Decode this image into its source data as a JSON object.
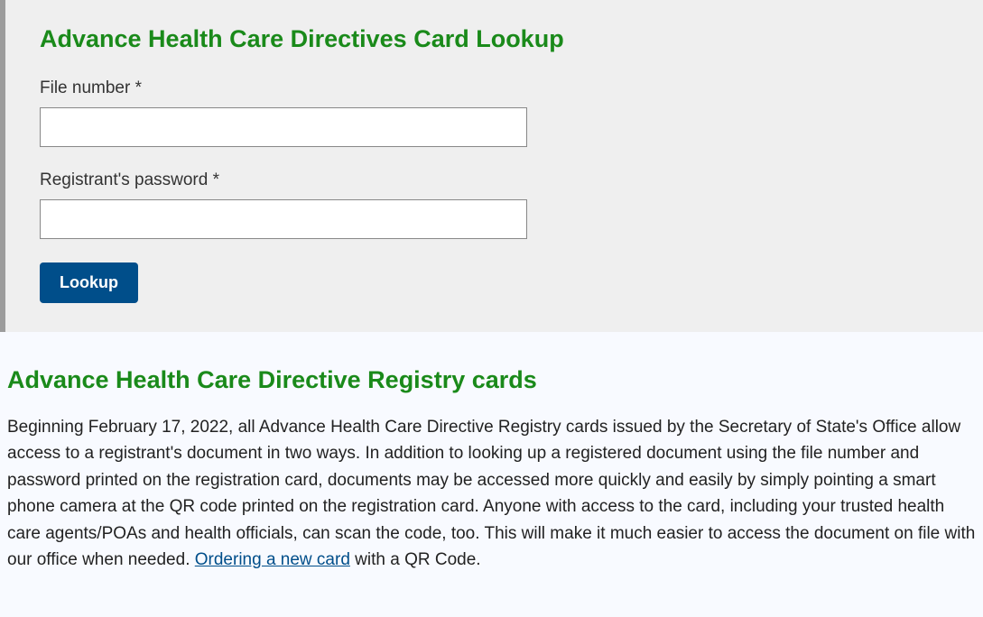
{
  "lookup": {
    "title": "Advance Health Care Directives Card Lookup",
    "file_number_label": "File number *",
    "password_label": "Registrant's password *",
    "button_label": "Lookup"
  },
  "content": {
    "title": "Advance Health Care Directive Registry cards",
    "paragraph_pre_link": "Beginning February 17, 2022, all Advance Health Care Directive Registry cards issued by the Secretary of State's Office allow access to a registrant's document in two ways. In addition to looking up a registered document using the file number and password printed on the registration card, documents may be accessed more quickly and easily by simply pointing a smart phone camera at the QR code printed on the registration card. Anyone with access to the card, including your trusted health care agents/POAs and health officials, can scan the code, too. This will make it much easier to access the document on file with our office when needed. ",
    "link_text": "Ordering a new card",
    "paragraph_post_link": " with a QR Code."
  }
}
